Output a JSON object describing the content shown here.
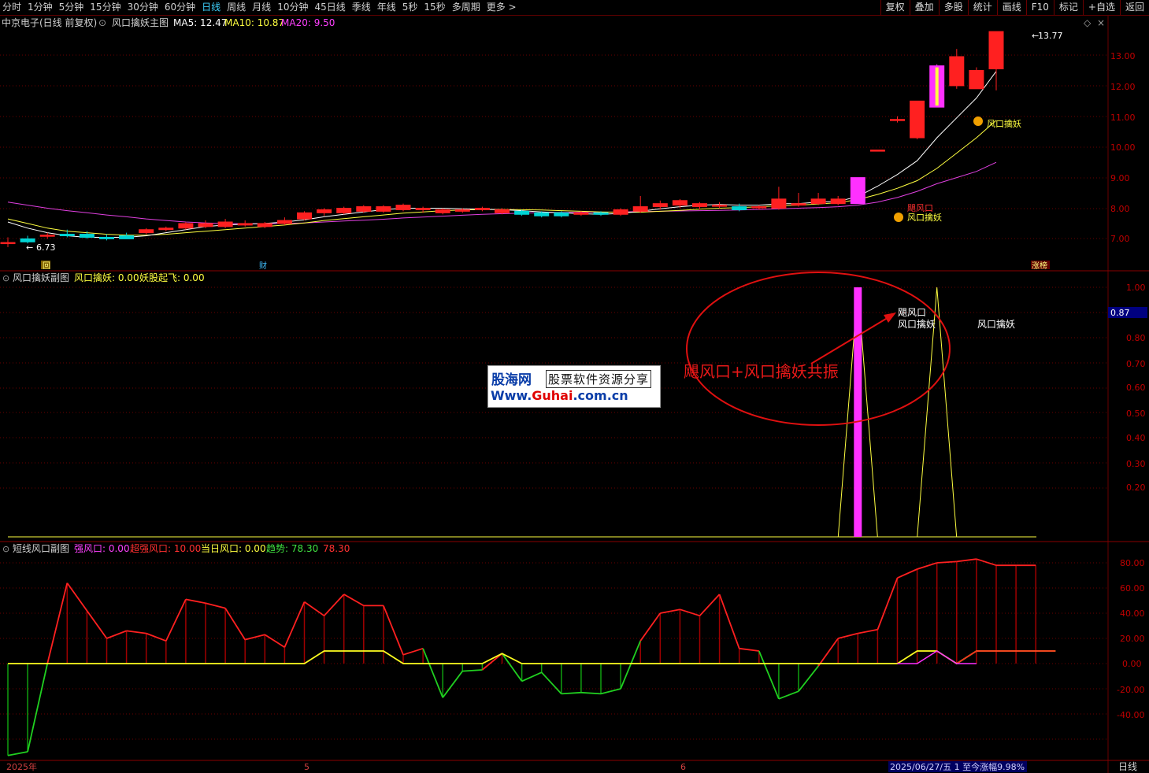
{
  "toolbar": {
    "periods": [
      "分时",
      "1分钟",
      "5分钟",
      "15分钟",
      "30分钟",
      "60分钟",
      "日线",
      "周线",
      "月线",
      "10分钟",
      "45日线",
      "季线",
      "年线",
      "5秒",
      "15秒",
      "多周期",
      "更多 >"
    ],
    "active_index": 6,
    "right_buttons": [
      "复权",
      "叠加",
      "多股",
      "统计",
      "画线",
      "F10",
      "标记",
      "+自选",
      "返回"
    ]
  },
  "main_panel": {
    "stock_title": "中京电子(日线 前复权)",
    "indicator_name": "风口擒妖主图",
    "ma5_label": "MA5: 12.47",
    "ma10_label": "MA10: 10.87",
    "ma20_label": "MA20: 9.50",
    "price_high_label": "13.77",
    "price_low_label": "6.73",
    "axis_ticks": [
      "13.00",
      "12.00",
      "11.00",
      "10.00",
      "9.00",
      "8.00",
      "7.00"
    ],
    "annot_jufengkou": "飓风口",
    "annot_qinyao_1": "风口擒妖",
    "annot_qinyao_2": "风口擒妖",
    "marker_hui": "回",
    "marker_cai": "财",
    "marker_zhangting": "涨榜"
  },
  "sub_panel_1": {
    "title": "风口擒妖副图",
    "label_a": "风口擒妖: 0.00",
    "label_b": "妖股起飞: 0.00",
    "axis_ticks": [
      "1.00",
      "0.90",
      "0.80",
      "0.70",
      "0.60",
      "0.50",
      "0.40",
      "0.30",
      "0.20"
    ],
    "current_value": "0.87",
    "annot_1a": "飓风口",
    "annot_1b": "风口擒妖",
    "annot_2": "风口擒妖",
    "callout_text": "飓风口+风口擒妖共振"
  },
  "sub_panel_2": {
    "title": "短线风口副图",
    "label_qiang": "强风口: 0.00",
    "label_chaoqiang": "超强风口: 10.00",
    "label_dangri": "当日风口: 0.00",
    "label_qushi": "趋势: 78.30",
    "label_qushi_2": "78.30",
    "axis_ticks": [
      "80.00",
      "60.00",
      "40.00",
      "20.00",
      "0.00",
      "-20.00",
      "-40.00"
    ]
  },
  "watermark": {
    "line1a": "股海网",
    "line1b": "股票软件资源分享",
    "line2a": "Www.",
    "line2b": "Guhai",
    "line2c": ".com.cn"
  },
  "bottom_bar": {
    "date_start": "2025年",
    "month_5": "5",
    "month_6": "6",
    "status": "2025/06/27/五 1 至今涨幅9.98%",
    "period_label": "日线"
  },
  "colors": {
    "up_red": "#ff2020",
    "down_cyan": "#00d4d4",
    "ma5": "#ffffff",
    "ma10": "#ffff40",
    "ma20": "#e040e0",
    "grid": "#6a0000",
    "magenta": "#ff30ff",
    "green": "#20d020"
  },
  "chart_data": [
    {
      "type": "candlestick",
      "title": "风口擒妖主图",
      "ylim": [
        6.4,
        14.3
      ],
      "candles": [
        {
          "o": 6.85,
          "h": 7.05,
          "l": 6.73,
          "c": 6.88
        },
        {
          "o": 7.0,
          "h": 7.1,
          "l": 6.85,
          "c": 6.9
        },
        {
          "o": 7.1,
          "h": 7.2,
          "l": 7.0,
          "c": 7.12
        },
        {
          "o": 7.15,
          "h": 7.3,
          "l": 7.05,
          "c": 7.1
        },
        {
          "o": 7.15,
          "h": 7.25,
          "l": 7.0,
          "c": 7.05
        },
        {
          "o": 7.05,
          "h": 7.15,
          "l": 6.95,
          "c": 7.0
        },
        {
          "o": 7.1,
          "h": 7.2,
          "l": 7.0,
          "c": 7.0
        },
        {
          "o": 7.2,
          "h": 7.35,
          "l": 7.15,
          "c": 7.3
        },
        {
          "o": 7.3,
          "h": 7.4,
          "l": 7.25,
          "c": 7.35
        },
        {
          "o": 7.35,
          "h": 7.55,
          "l": 7.3,
          "c": 7.5
        },
        {
          "o": 7.4,
          "h": 7.6,
          "l": 7.35,
          "c": 7.5
        },
        {
          "o": 7.4,
          "h": 7.65,
          "l": 7.35,
          "c": 7.55
        },
        {
          "o": 7.45,
          "h": 7.6,
          "l": 7.4,
          "c": 7.5
        },
        {
          "o": 7.4,
          "h": 7.55,
          "l": 7.35,
          "c": 7.5
        },
        {
          "o": 7.5,
          "h": 7.7,
          "l": 7.45,
          "c": 7.6
        },
        {
          "o": 7.65,
          "h": 7.9,
          "l": 7.6,
          "c": 7.85
        },
        {
          "o": 7.85,
          "h": 8.0,
          "l": 7.75,
          "c": 7.95
        },
        {
          "o": 7.85,
          "h": 8.05,
          "l": 7.8,
          "c": 8.0
        },
        {
          "o": 7.9,
          "h": 8.1,
          "l": 7.85,
          "c": 8.05
        },
        {
          "o": 7.9,
          "h": 8.1,
          "l": 7.85,
          "c": 8.05
        },
        {
          "o": 7.95,
          "h": 8.15,
          "l": 7.9,
          "c": 8.1
        },
        {
          "o": 7.95,
          "h": 8.05,
          "l": 7.85,
          "c": 8.0
        },
        {
          "o": 7.85,
          "h": 8.0,
          "l": 7.8,
          "c": 7.95
        },
        {
          "o": 7.9,
          "h": 8.0,
          "l": 7.85,
          "c": 7.95
        },
        {
          "o": 7.95,
          "h": 8.05,
          "l": 7.9,
          "c": 8.0
        },
        {
          "o": 7.85,
          "h": 8.0,
          "l": 7.8,
          "c": 7.95
        },
        {
          "o": 7.9,
          "h": 7.95,
          "l": 7.75,
          "c": 7.8
        },
        {
          "o": 7.85,
          "h": 7.9,
          "l": 7.7,
          "c": 7.75
        },
        {
          "o": 7.85,
          "h": 7.9,
          "l": 7.7,
          "c": 7.75
        },
        {
          "o": 7.8,
          "h": 7.9,
          "l": 7.75,
          "c": 7.85
        },
        {
          "o": 7.85,
          "h": 7.9,
          "l": 7.75,
          "c": 7.8
        },
        {
          "o": 7.8,
          "h": 8.0,
          "l": 7.75,
          "c": 7.95
        },
        {
          "o": 7.9,
          "h": 8.4,
          "l": 7.85,
          "c": 8.05
        },
        {
          "o": 8.05,
          "h": 8.25,
          "l": 7.95,
          "c": 8.15
        },
        {
          "o": 8.1,
          "h": 8.3,
          "l": 8.0,
          "c": 8.25
        },
        {
          "o": 8.05,
          "h": 8.2,
          "l": 7.95,
          "c": 8.15
        },
        {
          "o": 8.1,
          "h": 8.2,
          "l": 8.0,
          "c": 8.1
        },
        {
          "o": 8.05,
          "h": 8.15,
          "l": 7.9,
          "c": 7.95
        },
        {
          "o": 8.05,
          "h": 8.1,
          "l": 7.95,
          "c": 8.05
        },
        {
          "o": 8.0,
          "h": 8.7,
          "l": 7.95,
          "c": 8.3
        },
        {
          "o": 8.1,
          "h": 8.5,
          "l": 8.05,
          "c": 8.15
        },
        {
          "o": 8.15,
          "h": 8.5,
          "l": 8.1,
          "c": 8.3
        },
        {
          "o": 8.15,
          "h": 8.4,
          "l": 8.1,
          "c": 8.3
        },
        {
          "o": 8.15,
          "h": 9.0,
          "l": 8.15,
          "c": 9.0,
          "color": "magenta"
        },
        {
          "o": 9.9,
          "h": 9.9,
          "l": 9.9,
          "c": 9.9
        },
        {
          "o": 10.9,
          "h": 11.0,
          "l": 10.8,
          "c": 10.9
        },
        {
          "o": 10.3,
          "h": 11.5,
          "l": 10.25,
          "c": 11.5
        },
        {
          "o": 11.3,
          "h": 12.7,
          "l": 11.3,
          "c": 12.65,
          "color": "magenta",
          "inner": "yellow"
        },
        {
          "o": 12.0,
          "h": 13.2,
          "l": 11.9,
          "c": 12.95
        },
        {
          "o": 11.9,
          "h": 12.6,
          "l": 11.9,
          "c": 12.5
        },
        {
          "o": 12.55,
          "h": 13.77,
          "l": 11.85,
          "c": 13.77
        }
      ],
      "ma5": [
        7.55,
        7.35,
        7.2,
        7.1,
        7.05,
        7.05,
        7.05,
        7.1,
        7.2,
        7.3,
        7.4,
        7.45,
        7.48,
        7.5,
        7.55,
        7.62,
        7.72,
        7.8,
        7.88,
        7.95,
        8.0,
        8.0,
        8.0,
        7.98,
        7.97,
        7.95,
        7.92,
        7.88,
        7.85,
        7.82,
        7.8,
        7.83,
        7.9,
        7.98,
        8.05,
        8.1,
        8.12,
        8.1,
        8.1,
        8.15,
        8.15,
        8.2,
        8.22,
        8.38,
        8.72,
        9.1,
        9.55,
        10.3,
        10.95,
        11.6,
        12.47
      ],
      "ma10": [
        7.65,
        7.5,
        7.35,
        7.25,
        7.2,
        7.15,
        7.12,
        7.12,
        7.15,
        7.2,
        7.25,
        7.3,
        7.35,
        7.4,
        7.45,
        7.52,
        7.6,
        7.66,
        7.72,
        7.78,
        7.84,
        7.88,
        7.92,
        7.94,
        7.96,
        7.96,
        7.95,
        7.94,
        7.92,
        7.9,
        7.88,
        7.87,
        7.87,
        7.9,
        7.93,
        7.97,
        8.0,
        8.02,
        8.05,
        8.08,
        8.1,
        8.14,
        8.18,
        8.28,
        8.45,
        8.65,
        8.9,
        9.3,
        9.8,
        10.3,
        10.87
      ],
      "ma20": [
        8.2,
        8.1,
        8.0,
        7.92,
        7.85,
        7.78,
        7.72,
        7.65,
        7.6,
        7.55,
        7.52,
        7.5,
        7.49,
        7.49,
        7.5,
        7.52,
        7.55,
        7.58,
        7.61,
        7.64,
        7.68,
        7.71,
        7.74,
        7.77,
        7.8,
        7.82,
        7.84,
        7.85,
        7.86,
        7.87,
        7.87,
        7.88,
        7.89,
        7.9,
        7.91,
        7.92,
        7.93,
        7.94,
        7.96,
        7.98,
        8.0,
        8.02,
        8.05,
        8.1,
        8.2,
        8.35,
        8.55,
        8.8,
        9.0,
        9.2,
        9.5
      ]
    },
    {
      "type": "line",
      "title": "风口擒妖副图",
      "ylim": [
        0,
        1.05
      ],
      "series": [
        {
          "name": "风口擒妖",
          "values": [
            {
              "x": 43,
              "y": 1.0
            },
            {
              "x": 47,
              "y": 1.0
            }
          ]
        },
        {
          "name": "飓风口",
          "values": [
            {
              "x": 43,
              "y": 1.0
            }
          ]
        }
      ]
    },
    {
      "type": "line",
      "title": "短线风口副图",
      "ylim": [
        -75,
        88
      ],
      "series": [
        {
          "name": "趋势",
          "values": [
            -73,
            -70,
            0,
            64,
            42,
            20,
            26,
            24,
            18,
            51,
            48,
            44,
            19,
            23,
            13,
            49,
            38,
            55,
            46,
            46,
            7,
            12,
            -27,
            -6,
            -5,
            8,
            -14,
            -7,
            -24,
            -23,
            -24,
            -20,
            18,
            40,
            43,
            38,
            55,
            12,
            10,
            -28,
            -22,
            -2,
            20,
            24,
            27,
            68,
            75,
            80,
            81,
            83,
            78,
            78,
            78
          ]
        },
        {
          "name": "超强风口",
          "values": [
            0,
            0,
            0,
            0,
            0,
            0,
            0,
            0,
            0,
            0,
            0,
            0,
            0,
            0,
            0,
            0,
            10,
            10,
            10,
            10,
            0,
            0,
            0,
            0,
            0,
            8,
            0,
            0,
            0,
            0,
            0,
            0,
            0,
            0,
            0,
            0,
            0,
            0,
            0,
            0,
            0,
            0,
            0,
            0,
            0,
            0,
            10,
            10,
            0,
            10,
            10,
            10,
            10,
            10
          ]
        },
        {
          "name": "强风口",
          "values": [
            0,
            0,
            0,
            0,
            0,
            0,
            0,
            0,
            0,
            0,
            0,
            0,
            0,
            0,
            0,
            0,
            0,
            0,
            0,
            0,
            0,
            0,
            0,
            0,
            0,
            0,
            0,
            0,
            0,
            0,
            0,
            0,
            0,
            0,
            0,
            0,
            0,
            0,
            0,
            0,
            0,
            0,
            0,
            0,
            0,
            0,
            0,
            10,
            0,
            0,
            0,
            0,
            0,
            0
          ]
        }
      ]
    }
  ]
}
